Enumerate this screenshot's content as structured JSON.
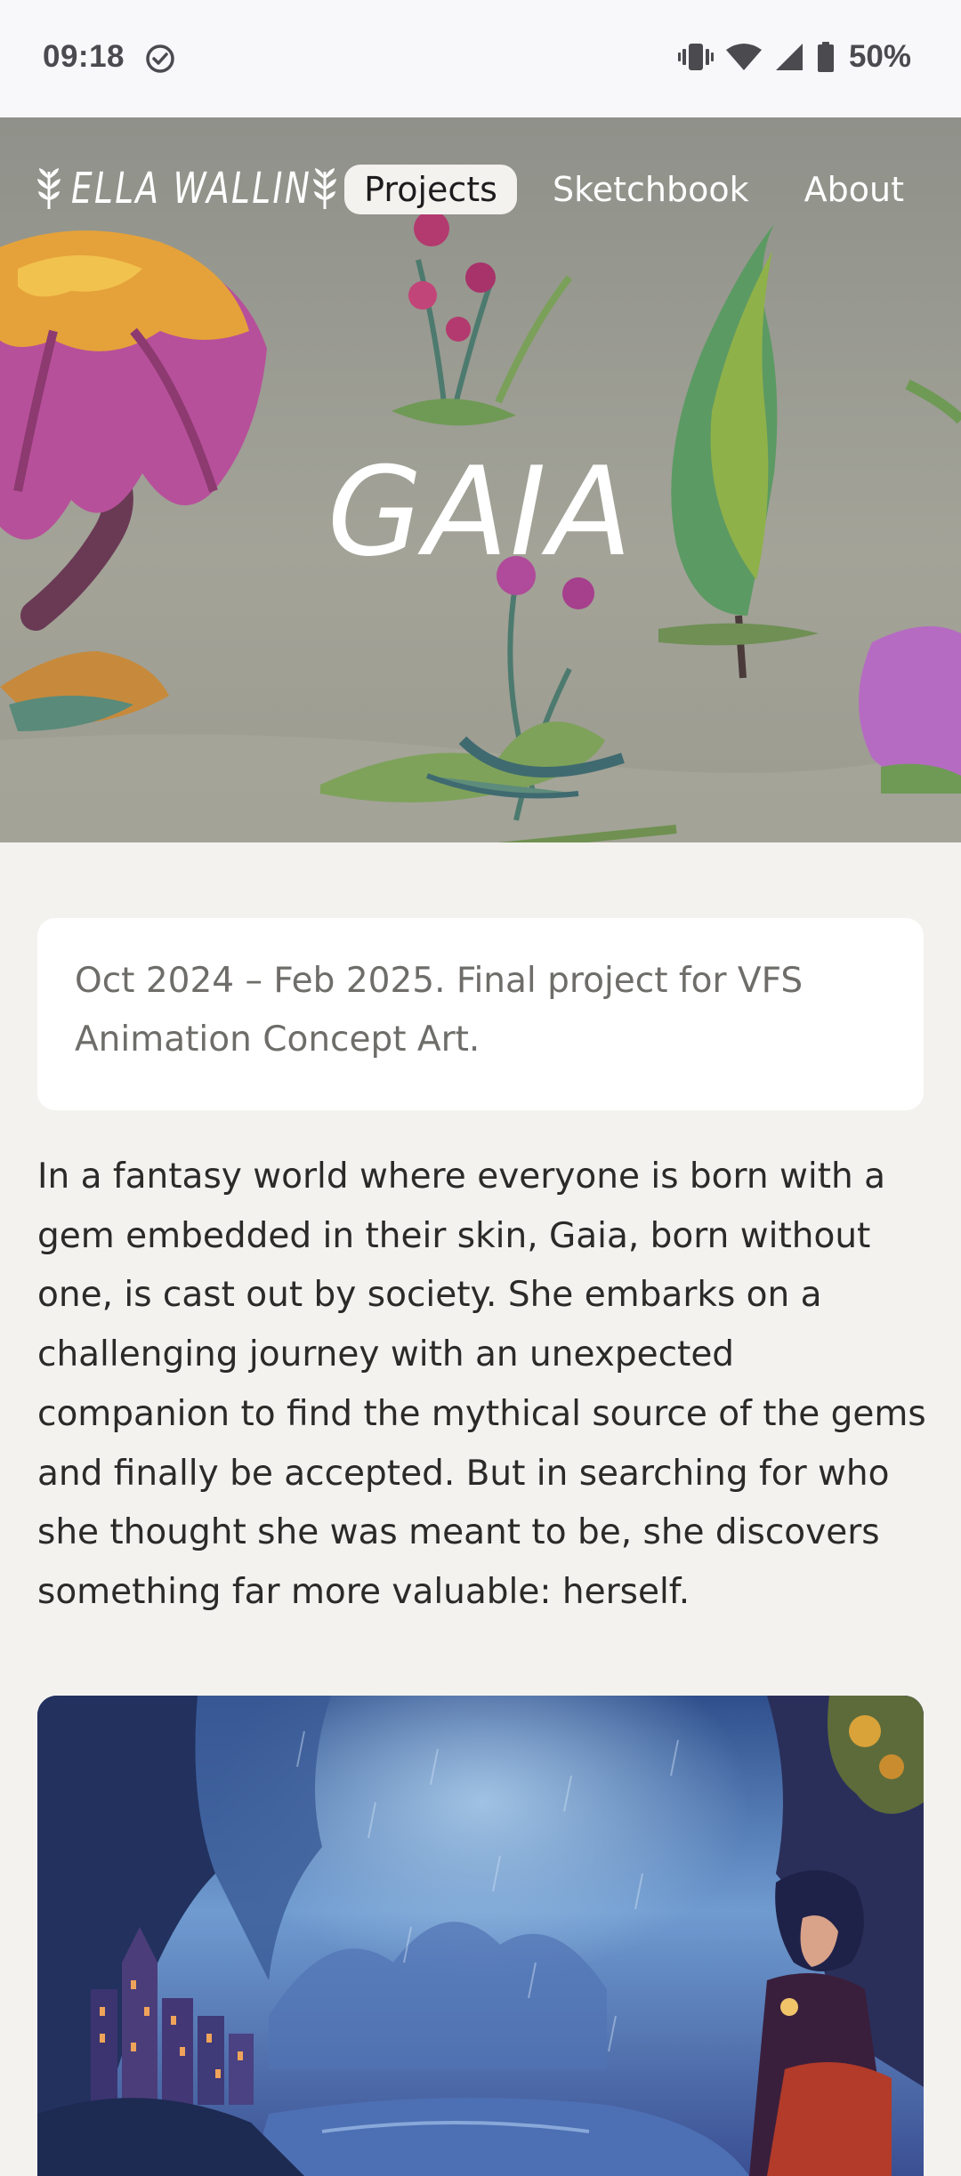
{
  "status_bar": {
    "time": "09:18",
    "battery": "50%",
    "icons": [
      "sync-done-icon",
      "vibrate-icon",
      "wifi-icon",
      "signal-icon",
      "battery-icon"
    ]
  },
  "nav": {
    "logo": "ELLA WALLIN",
    "links": [
      {
        "label": "Projects",
        "active": true
      },
      {
        "label": "Sketchbook",
        "active": false
      },
      {
        "label": "About",
        "active": false
      }
    ]
  },
  "hero": {
    "title": "GAIA"
  },
  "project": {
    "meta": "Oct 2024 – Feb 2025. Final project for VFS Animation Concept Art.",
    "description": "In a fantasy world where everyone is born with a gem embedded in their skin, Gaia, born without one, is cast out by society. She embarks on a challenging journey with an unexpected companion to find the mythical source of the gems and finally be accepted. But in searching for who she thought she was meant to be, she discovers something far more valuable: herself."
  },
  "colors": {
    "page_bg": "#f3f2ef",
    "hero_bg": "#9c9c92",
    "nav_active_bg": "#f4f2ee",
    "text": "#2b2a28",
    "muted_text": "#6e6d6a"
  }
}
